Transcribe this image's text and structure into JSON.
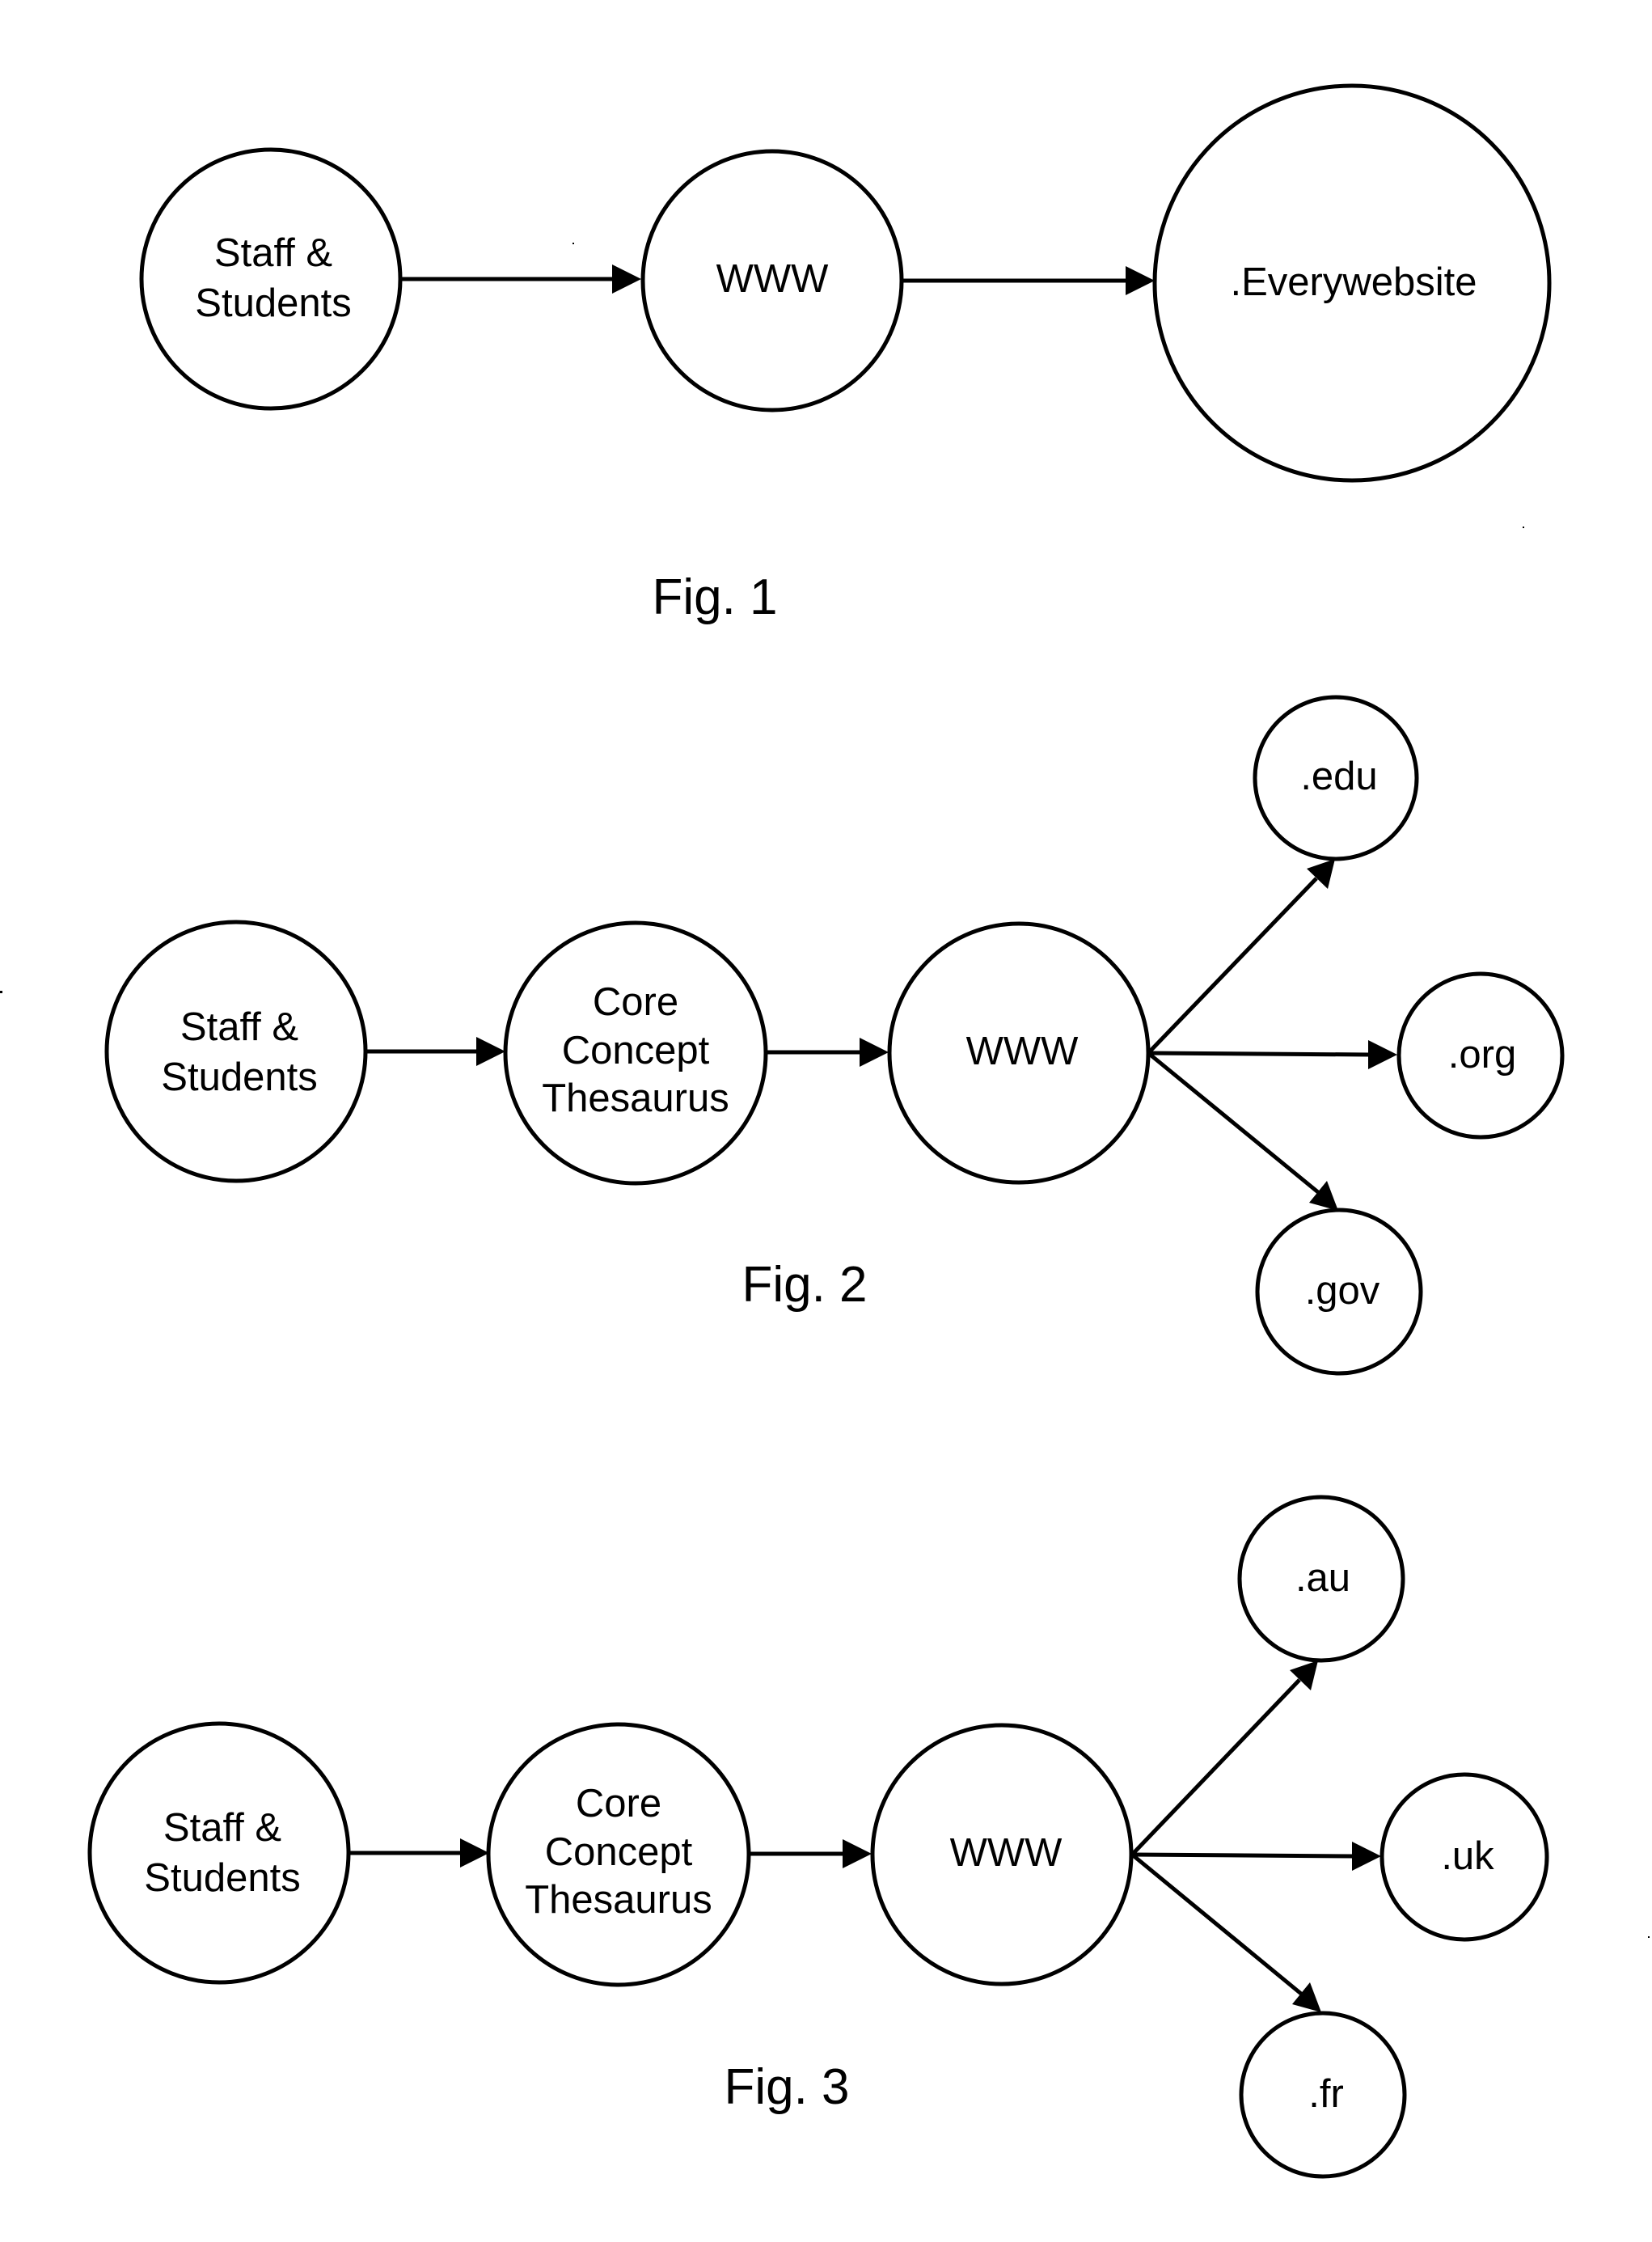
{
  "document": {
    "type": "patent drawing sheet",
    "colors": {
      "ink": "#000000",
      "paper": "#ffffff"
    }
  },
  "figures": [
    {
      "id": "fig1",
      "caption": "Fig. 1",
      "nodes": [
        {
          "id": "staff",
          "lines": [
            "Staff &",
            "Students"
          ]
        },
        {
          "id": "www",
          "lines": [
            "WWW"
          ]
        },
        {
          "id": "every",
          "lines": [
            ".Everywebsite"
          ]
        }
      ],
      "edges": [
        {
          "from": "staff",
          "to": "www"
        },
        {
          "from": "www",
          "to": "every"
        }
      ]
    },
    {
      "id": "fig2",
      "caption": "Fig. 2",
      "nodes": [
        {
          "id": "staff",
          "lines": [
            "Staff &",
            "Students"
          ]
        },
        {
          "id": "thesaurus",
          "lines": [
            "Core",
            "Concept",
            "Thesaurus"
          ]
        },
        {
          "id": "www",
          "lines": [
            "WWW"
          ]
        },
        {
          "id": "edu",
          "lines": [
            ".edu"
          ]
        },
        {
          "id": "org",
          "lines": [
            ".org"
          ]
        },
        {
          "id": "gov",
          "lines": [
            ".gov"
          ]
        }
      ],
      "edges": [
        {
          "from": "staff",
          "to": "thesaurus"
        },
        {
          "from": "thesaurus",
          "to": "www"
        },
        {
          "from": "www",
          "to": "edu"
        },
        {
          "from": "www",
          "to": "org"
        },
        {
          "from": "www",
          "to": "gov"
        }
      ]
    },
    {
      "id": "fig3",
      "caption": "Fig. 3",
      "nodes": [
        {
          "id": "staff",
          "lines": [
            "Staff &",
            "Students"
          ]
        },
        {
          "id": "thesaurus",
          "lines": [
            "Core",
            "Concept",
            "Thesaurus"
          ]
        },
        {
          "id": "www",
          "lines": [
            "WWW"
          ]
        },
        {
          "id": "au",
          "lines": [
            ".au"
          ]
        },
        {
          "id": "uk",
          "lines": [
            ".uk"
          ]
        },
        {
          "id": "fr",
          "lines": [
            ".fr"
          ]
        }
      ],
      "edges": [
        {
          "from": "staff",
          "to": "thesaurus"
        },
        {
          "from": "thesaurus",
          "to": "www"
        },
        {
          "from": "www",
          "to": "au"
        },
        {
          "from": "www",
          "to": "uk"
        },
        {
          "from": "www",
          "to": "fr"
        }
      ]
    }
  ]
}
